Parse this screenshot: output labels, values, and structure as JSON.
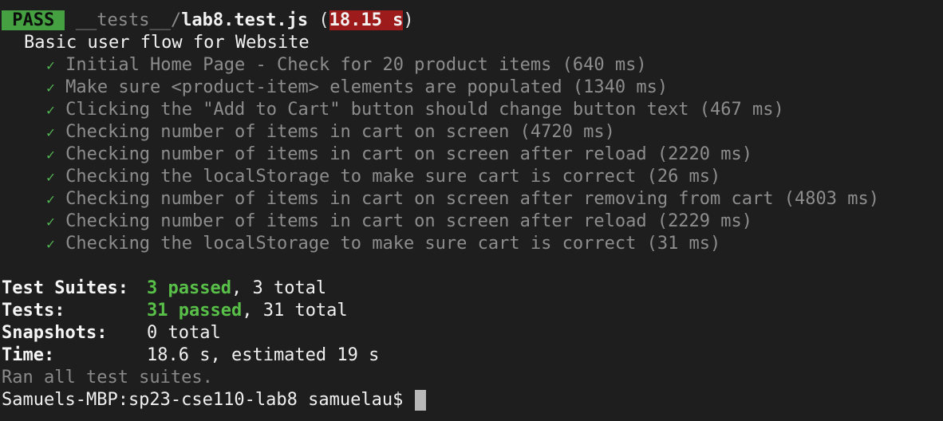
{
  "header": {
    "status": "PASS",
    "path_dir": "__tests__/",
    "path_file": "lab8.test.js",
    "time_open": "(",
    "time": "18.15 s",
    "time_close": ")"
  },
  "suite": {
    "name": "Basic user flow for Website",
    "tests": [
      {
        "check": "✓",
        "text": "Initial Home Page - Check for 20 product items (640 ms)"
      },
      {
        "check": "✓",
        "text": "Make sure <product-item> elements are populated (1340 ms)"
      },
      {
        "check": "✓",
        "text": "Clicking the \"Add to Cart\" button should change button text (467 ms)"
      },
      {
        "check": "✓",
        "text": "Checking number of items in cart on screen (4720 ms)"
      },
      {
        "check": "✓",
        "text": "Checking number of items in cart on screen after reload (2220 ms)"
      },
      {
        "check": "✓",
        "text": "Checking the localStorage to make sure cart is correct (26 ms)"
      },
      {
        "check": "✓",
        "text": "Checking number of items in cart on screen after removing from cart (4803 ms)"
      },
      {
        "check": "✓",
        "text": "Checking number of items in cart on screen after reload (2229 ms)"
      },
      {
        "check": "✓",
        "text": "Checking the localStorage to make sure cart is correct (31 ms)"
      }
    ]
  },
  "summary": {
    "suites_label": "Test Suites:",
    "suites_passed": "3 passed",
    "suites_rest": ", 3 total",
    "tests_label": "Tests:",
    "tests_passed": "31 passed",
    "tests_rest": ", 31 total",
    "snapshots_label": "Snapshots:",
    "snapshots_value": "0 total",
    "time_label": "Time:",
    "time_value": "18.6 s, estimated 19 s",
    "ran_all": "Ran all test suites."
  },
  "prompt": {
    "text": "Samuels-MBP:sp23-cse110-lab8 samuelau$ "
  },
  "colors": {
    "background": "#1e1e1e",
    "pass_badge": "#44a040",
    "time_badge": "#9e1b1b",
    "check": "#52b552",
    "passed_text": "#58c048"
  }
}
